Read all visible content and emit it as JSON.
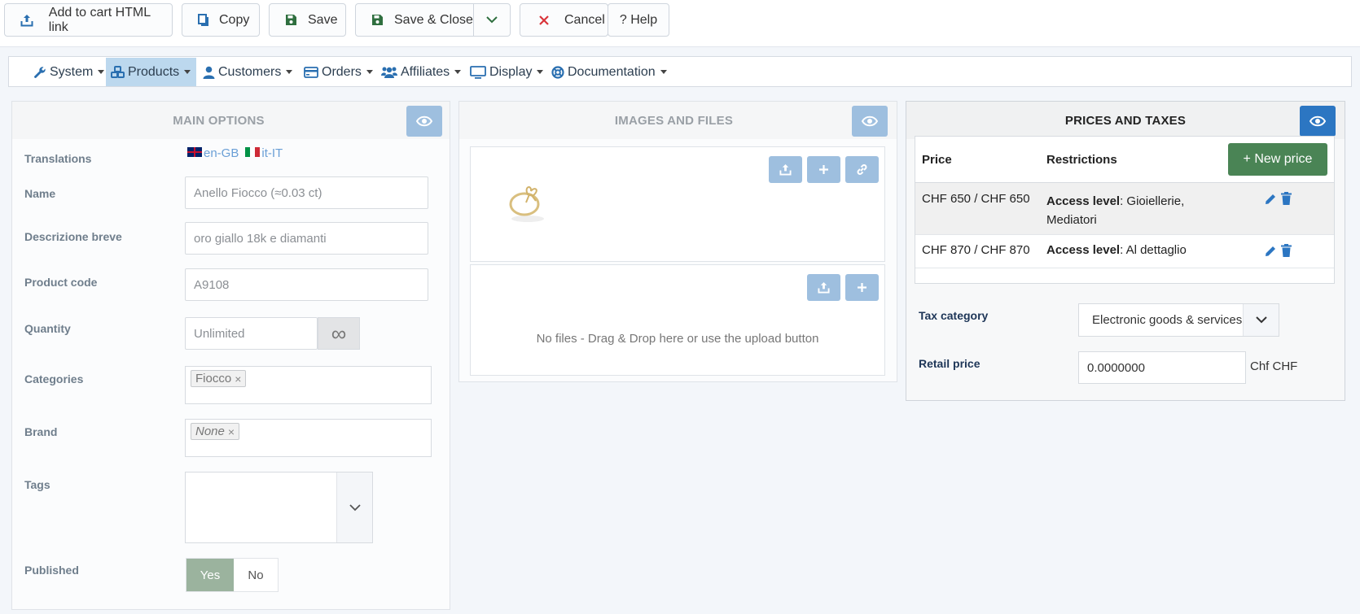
{
  "toolbar": {
    "add_to_cart_label": "Add to cart HTML link",
    "copy_label": "Copy",
    "save_label": "Save",
    "save_close_label": "Save & Close",
    "cancel_label": "Cancel",
    "help_label": "? Help"
  },
  "menu": {
    "items": [
      {
        "label": "System",
        "icon": "wrench-icon"
      },
      {
        "label": "Products",
        "icon": "cubes-icon",
        "active": true
      },
      {
        "label": "Customers",
        "icon": "user-icon"
      },
      {
        "label": "Orders",
        "icon": "credit-card-icon"
      },
      {
        "label": "Affiliates",
        "icon": "users-icon"
      },
      {
        "label": "Display",
        "icon": "monitor-icon"
      },
      {
        "label": "Documentation",
        "icon": "lifebuoy-icon"
      }
    ]
  },
  "main_options": {
    "title": "MAIN OPTIONS",
    "translations_label": "Translations",
    "translations": [
      "en-GB",
      "it-IT"
    ],
    "name_label": "Name",
    "name_value": "Anello Fiocco (≈0.03 ct)",
    "short_desc_label": "Descrizione breve",
    "short_desc_value": "oro giallo 18k e diamanti",
    "product_code_label": "Product code",
    "product_code_value": "A9108",
    "quantity_label": "Quantity",
    "quantity_placeholder": "Unlimited",
    "quantity_button": "∞",
    "categories_label": "Categories",
    "categories": [
      "Fiocco"
    ],
    "brand_label": "Brand",
    "brand_value": "None",
    "tags_label": "Tags",
    "published_label": "Published",
    "published_yes": "Yes",
    "published_no": "No"
  },
  "images_files": {
    "title": "IMAGES AND FILES",
    "no_files_text": "No files - Drag & Drop here or use the upload button"
  },
  "prices_taxes": {
    "title": "PRICES AND TAXES",
    "col_price": "Price",
    "col_restrictions": "Restrictions",
    "new_price_label": "+ New price",
    "rows": [
      {
        "price": "CHF 650 / CHF 650",
        "restriction_key": "Access level",
        "restriction_value": ": Gioiellerie, Mediatori"
      },
      {
        "price": "CHF 870 / CHF 870",
        "restriction_key": "Access level",
        "restriction_value": ": Al dettaglio"
      }
    ],
    "tax_category_label": "Tax category",
    "tax_category_value": "Electronic goods & services",
    "retail_price_label": "Retail price",
    "retail_price_value": "0.0000000",
    "retail_currency": "Chf CHF"
  },
  "colors": {
    "accent_blue": "#2c76c2",
    "light_blue": "#9ebfdf",
    "green_button": "#4a8455",
    "cancel_red": "#d9343a",
    "save_green": "#2f6f3f"
  }
}
